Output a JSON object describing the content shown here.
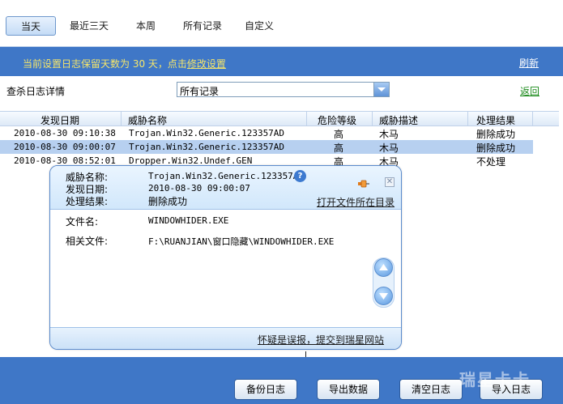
{
  "tabs": [
    "当天",
    "最近三天",
    "本周",
    "所有记录",
    "自定义"
  ],
  "info": {
    "prefix": "当前设置日志保留天数为 30 天，点击",
    "link": "修改设置",
    "refresh": "刷新"
  },
  "filter": {
    "title": "查杀日志详情",
    "selected": "所有记录",
    "back": "返回"
  },
  "table": {
    "headers": [
      "发现日期",
      "威胁名称",
      "危险等级",
      "威胁描述",
      "处理结果"
    ],
    "rows": [
      {
        "date": "2010-08-30 09:10:38",
        "name": "Trojan.Win32.Generic.123357AD",
        "level": "高",
        "desc": "木马",
        "result": "删除成功"
      },
      {
        "date": "2010-08-30 09:00:07",
        "name": "Trojan.Win32.Generic.123357AD",
        "level": "高",
        "desc": "木马",
        "result": "删除成功"
      },
      {
        "date": "2010-08-30 08:52:01",
        "name": "Dropper.Win32.Undef.GEN",
        "level": "高",
        "desc": "木马",
        "result": "不处理"
      }
    ]
  },
  "popup": {
    "threat_label": "威胁名称:",
    "threat_value": "Trojan.Win32.Generic.123357AD",
    "date_label": "发现日期:",
    "date_value": "2010-08-30 09:00:07",
    "result_label": "处理结果:",
    "result_value": "删除成功",
    "open_dir": "打开文件所在目录",
    "file_label": "文件名:",
    "file_value": "WINDOWHIDER.EXE",
    "related_label": "相关文件:",
    "related_value": "F:\\RUANJIAN\\窗口隐藏\\WINDOWHIDER.EXE",
    "report": "怀疑是误报，提交到瑞星网站"
  },
  "buttons": [
    "备份日志",
    "导出数据",
    "清空日志",
    "导入日志"
  ],
  "watermark": "瑞星卡卡"
}
